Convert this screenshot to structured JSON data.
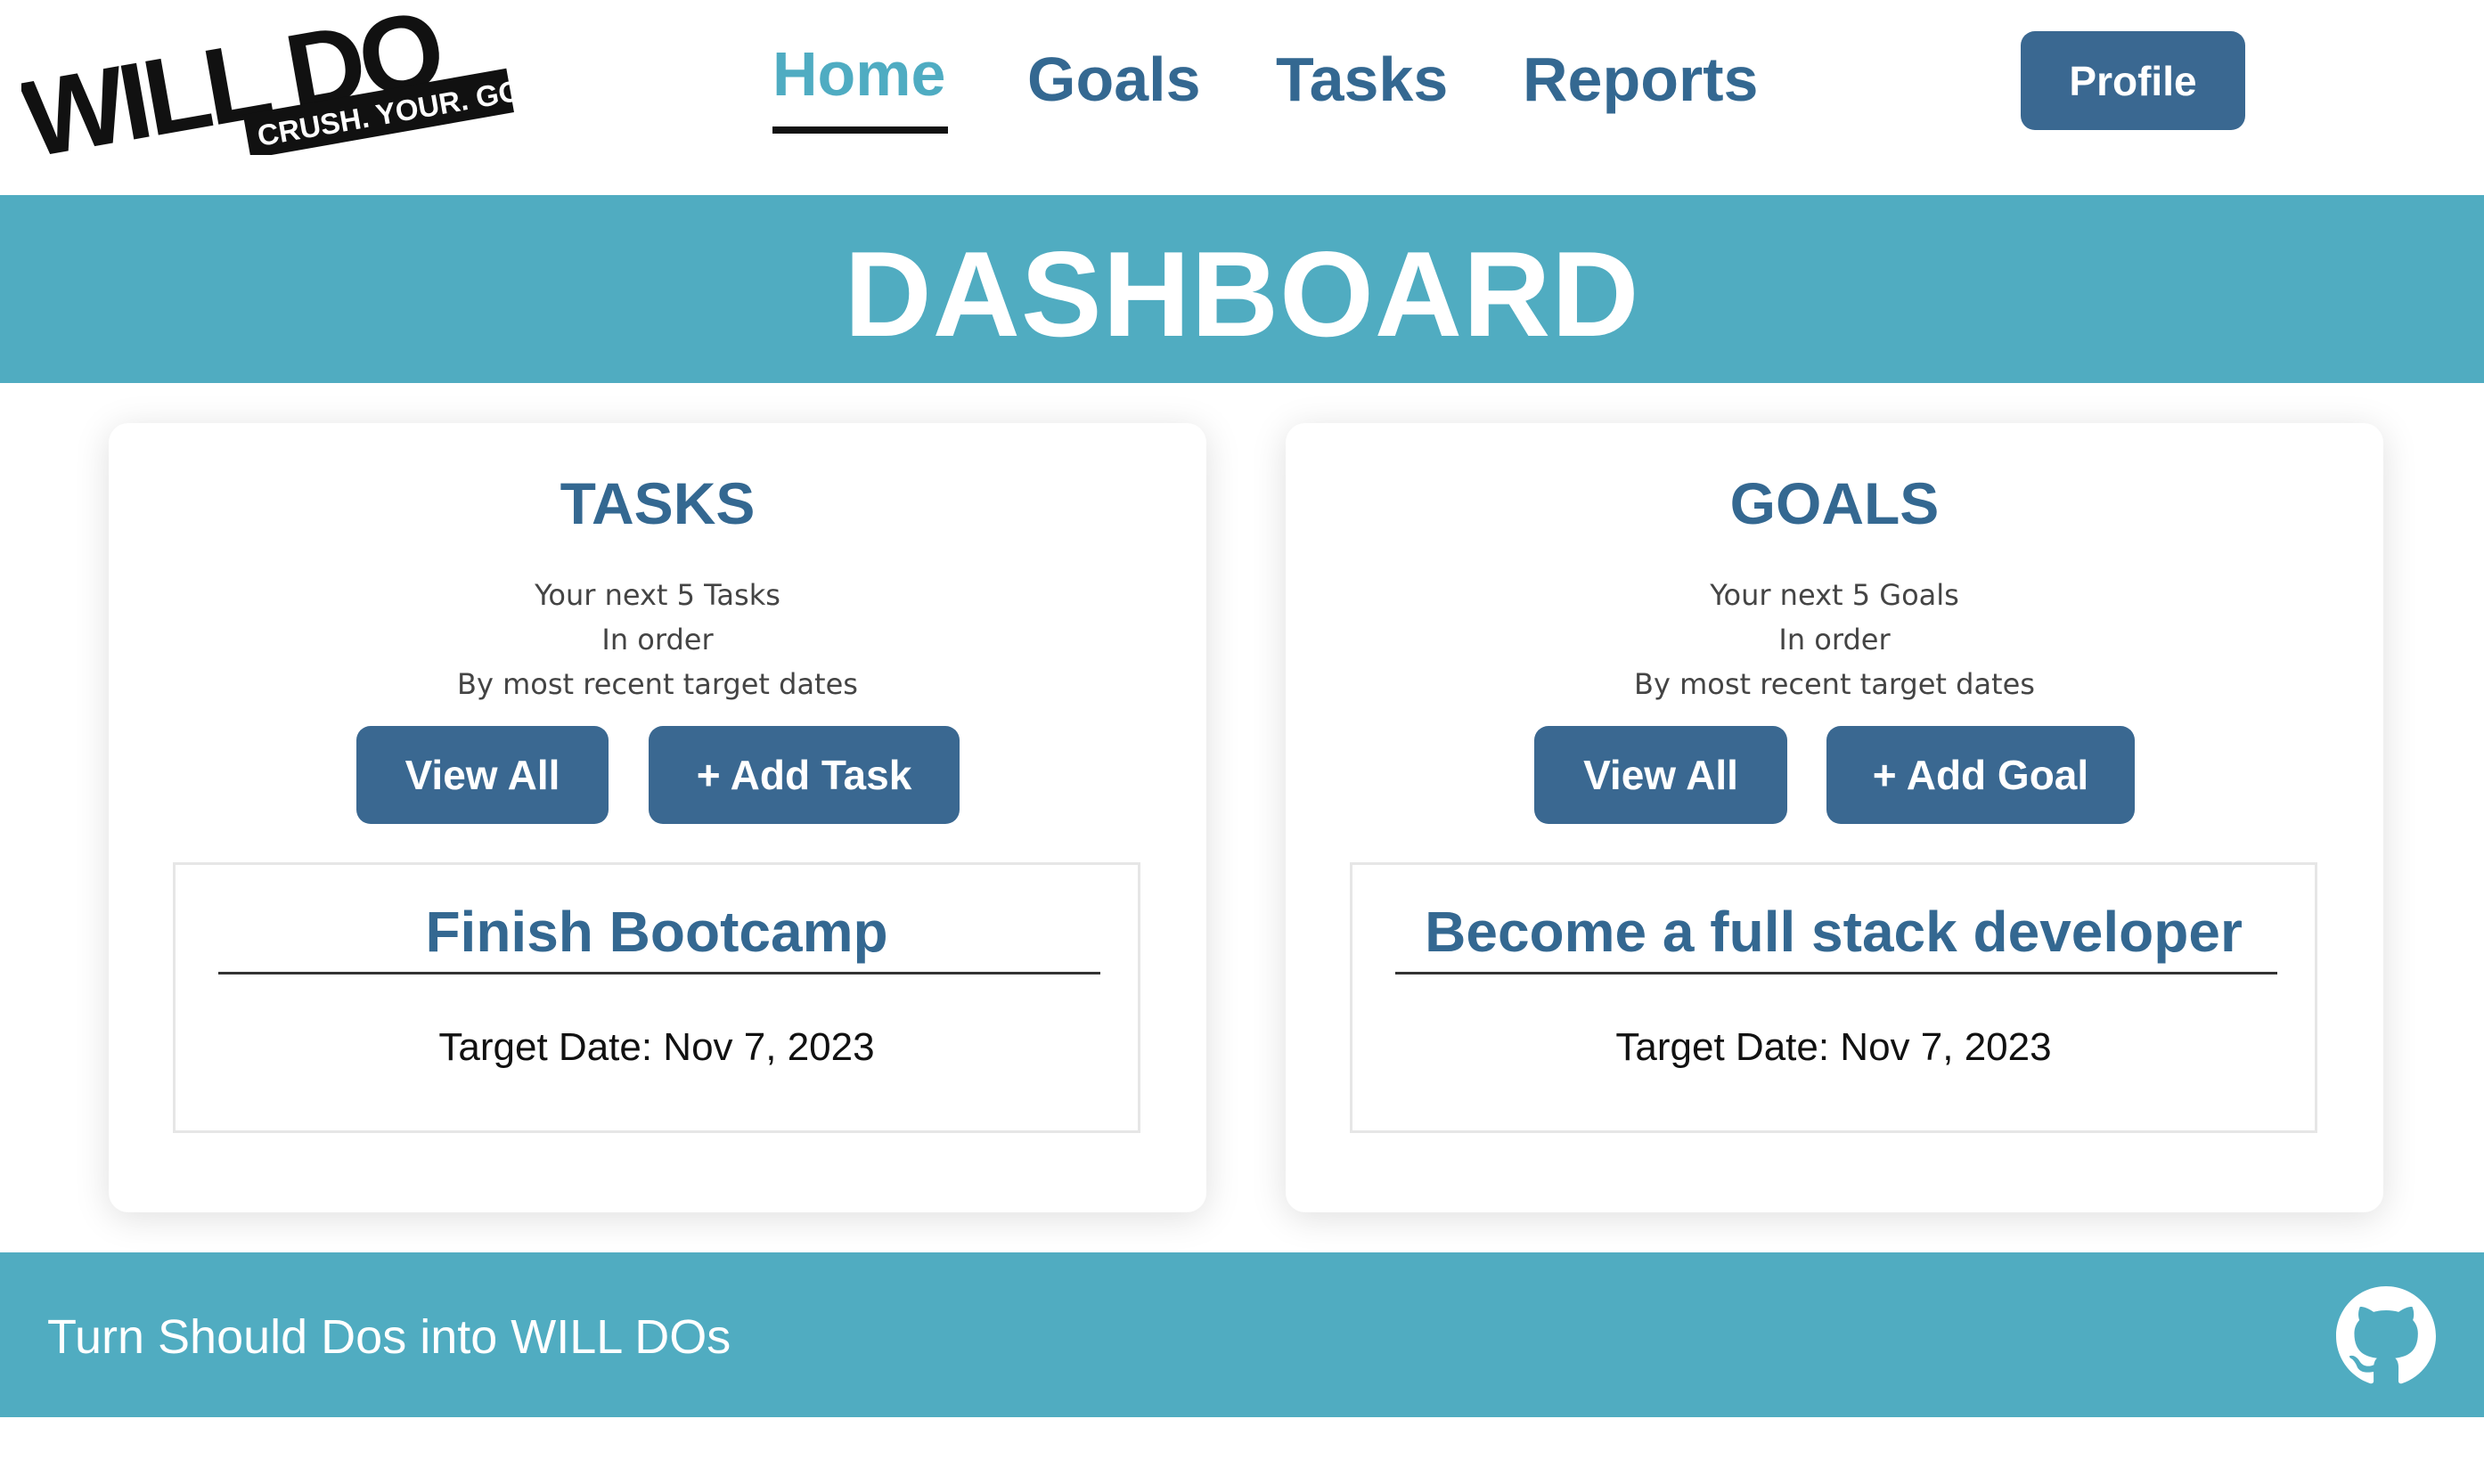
{
  "brand": {
    "logo_word": "WILL DO",
    "logo_tagline": "CRUSH. YOUR. GOALS."
  },
  "nav": {
    "home": "Home",
    "goals": "Goals",
    "tasks": "Tasks",
    "reports": "Reports",
    "active": "Home",
    "profile_label": "Profile"
  },
  "banner": {
    "title": "DASHBOARD"
  },
  "tasks_card": {
    "title": "TASKS",
    "desc_line1": "Your next 5 Tasks",
    "desc_line2": "In order",
    "desc_line3": "By most recent target dates",
    "view_all_label": "View All",
    "add_label": "+ Add Task",
    "items": [
      {
        "title": "Finish Bootcamp",
        "target_date": "Target Date: Nov 7, 2023"
      }
    ]
  },
  "goals_card": {
    "title": "GOALS",
    "desc_line1": "Your next 5 Goals",
    "desc_line2": "In order",
    "desc_line3": "By most recent target dates",
    "view_all_label": "View All",
    "add_label": "+ Add Goal",
    "items": [
      {
        "title": "Become a full stack developer",
        "target_date": "Target Date: Nov 7, 2023"
      }
    ]
  },
  "footer": {
    "tagline": "Turn Should Dos into WILL DOs",
    "github_icon": "github-icon"
  },
  "colors": {
    "primary_button": "#3a6891",
    "heading_blue": "#346891",
    "accent_teal": "#50acc1",
    "active_nav": "#4facc2"
  }
}
